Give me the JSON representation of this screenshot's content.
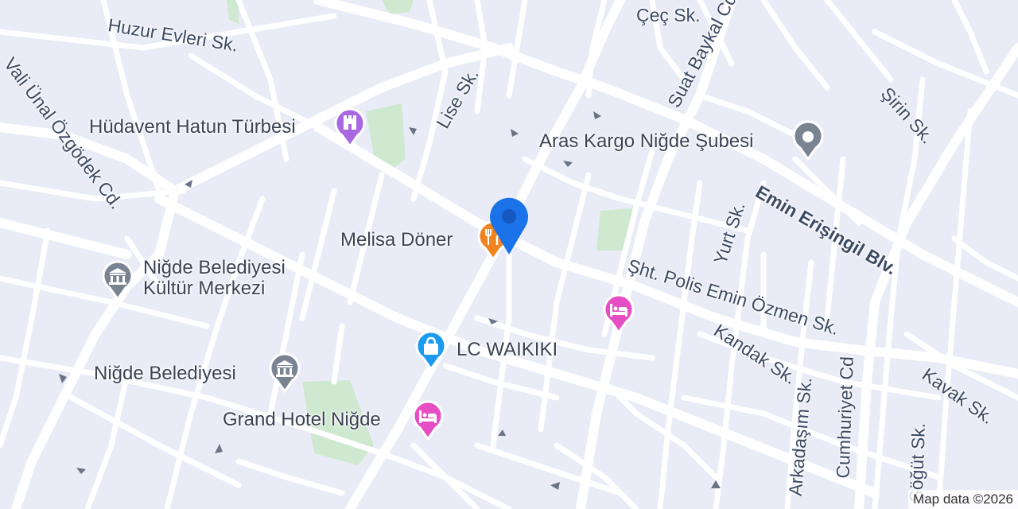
{
  "colors": {
    "background": "#e9ecf6",
    "road": "#ffffff",
    "park": "#cfe9d0",
    "poi_museum": "#a967e2",
    "poi_generic": "#7a8392",
    "poi_food": "#f2841f",
    "poi_shop": "#1a9af0",
    "poi_hotel": "#e64fc4",
    "location_marker": "#1a73e8",
    "label_text": "#3c4a63"
  },
  "road_labels": [
    {
      "text": "Huzur Evleri Sk."
    },
    {
      "text": "Vali Ünal Özgödek Cd."
    },
    {
      "text": "Lise Sk."
    },
    {
      "text": "Çeç Sk."
    },
    {
      "text": "Suat Baykal Cd"
    },
    {
      "text": "Şirin Sk."
    },
    {
      "text": "Emin Erişingil Blv."
    },
    {
      "text": "Yurt Sk."
    },
    {
      "text": "Şht. Polis Emin Özmen Sk."
    },
    {
      "text": "Kandak Sk."
    },
    {
      "text": "Kavak Sk."
    },
    {
      "text": "Arkadaşım Sk."
    },
    {
      "text": "Cumhuriyet Cd"
    },
    {
      "text": "Söğüt Sk."
    }
  ],
  "pois": [
    {
      "name": "Hüdavent Hatun Türbesi",
      "icon": "castle-icon",
      "category": "museum"
    },
    {
      "name": "Aras Kargo Niğde Şubesi",
      "icon": "dot-pin-icon",
      "category": "generic"
    },
    {
      "name": "Melisa Döner",
      "icon": "restaurant-icon",
      "category": "food"
    },
    {
      "name": "Niğde Belediyesi Kültür Merkezi",
      "icon": "government-building-icon",
      "category": "generic"
    },
    {
      "name": "LC WAIKIKI",
      "icon": "shopping-bag-icon",
      "category": "shop"
    },
    {
      "name": "Niğde Belediyesi",
      "icon": "government-building-icon",
      "category": "generic"
    },
    {
      "name": "Grand Hotel Niğde",
      "icon": "bed-icon",
      "category": "hotel"
    },
    {
      "name": "",
      "icon": "bed-icon",
      "category": "hotel"
    }
  ],
  "attribution": "Map data ©2026"
}
